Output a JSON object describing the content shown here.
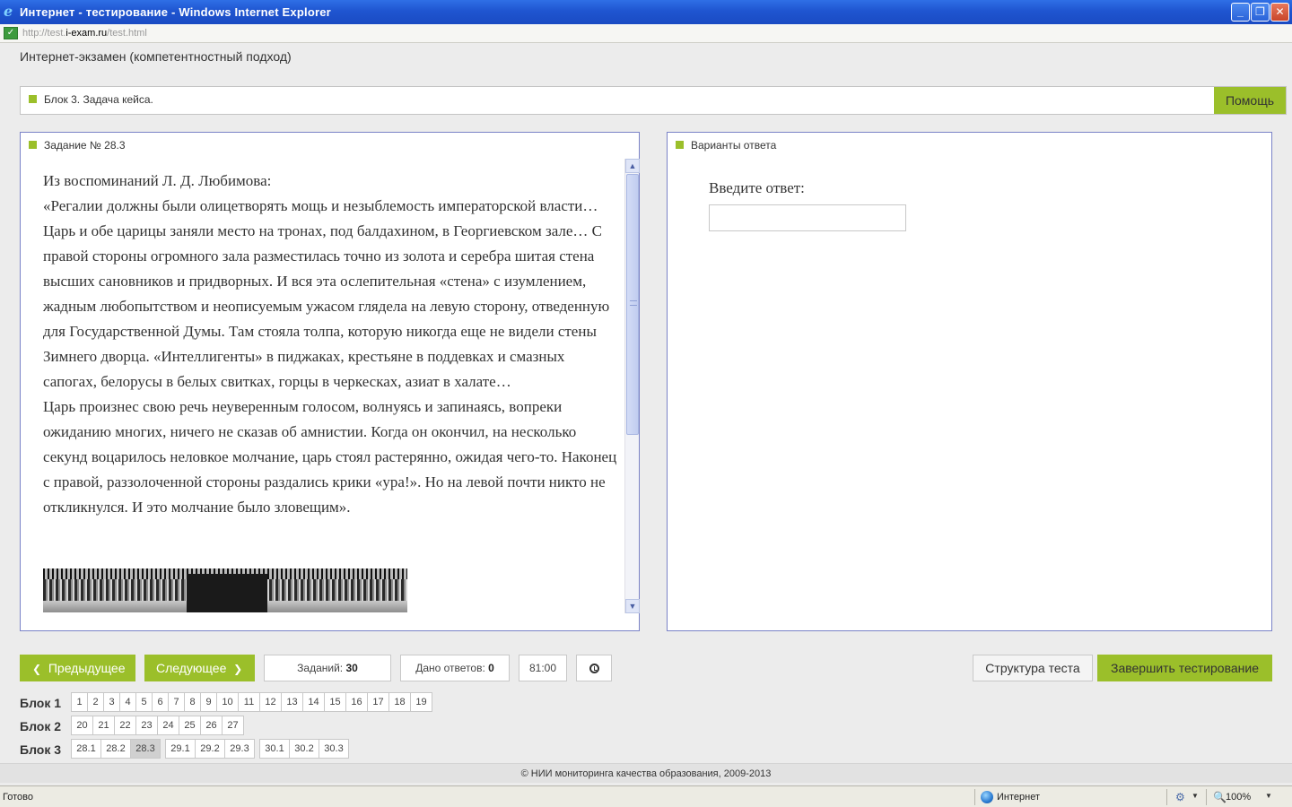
{
  "window": {
    "title": "Интернет - тестирование - Windows Internet Explorer",
    "minimize": "_",
    "maximize": "❐",
    "close": "✕"
  },
  "address": {
    "prefix": "http://test.",
    "host": "i-exam.ru",
    "path": "/test.html"
  },
  "page": {
    "title": "Интернет-экзамен (компетентностный подход)"
  },
  "block_bar": {
    "label": "Блок 3. Задача кейса.",
    "help_label": "Помощь"
  },
  "task": {
    "header": "Задание № 28.3",
    "paragraphs": [
      "Из воспоминаний Л. Д. Любимова:",
      "«Регалии должны были олицетворять мощь и незыблемость императорской власти… Царь и обе царицы заняли место на тронах, под балдахином, в Георгиевском зале… С правой стороны огромного зала разместилась точно из золота и серебра шитая стена высших сановников и придворных. И вся эта ослепительная «стена» с изумлением, жадным любопытством и неописуемым ужасом глядела на левую сторону, отведенную для Государственной Думы. Там стояла толпа, которую никогда еще не видели стены Зимнего дворца. «Интеллигенты» в пиджаках, крестьяне в поддевках и смазных сапогах, белорусы в белых свитках, горцы в черкесках, азиат в халате…",
      "Царь произнес свою речь неуверенным голосом, волнуясь и запинаясь, вопреки ожиданию многих, ничего не сказав об амнистии. Когда он окончил, на несколько секунд воцарилось неловкое молчание, царь стоял растерянно, ожидая чего-то. Наконец с правой, раззолоченной стороны раздались крики «ура!». Но на левой почти никто не откликнулся. И это молчание было зловещим»."
    ]
  },
  "answer": {
    "header": "Варианты ответа",
    "prompt": "Введите ответ:",
    "value": ""
  },
  "nav": {
    "prev_label": "Предыдущее",
    "next_label": "Следующее",
    "tasks_label": "Заданий: ",
    "tasks_value": "30",
    "answers_label": "Дано ответов: ",
    "answers_value": "0",
    "timer": "81:00",
    "structure_label": "Структура теста",
    "finish_label": "Завершить тестирование"
  },
  "blocks": [
    {
      "label": "Блок 1",
      "groups": [
        [
          "1",
          "2",
          "3",
          "4",
          "5",
          "6",
          "7",
          "8",
          "9",
          "10",
          "11",
          "12",
          "13",
          "14",
          "15",
          "16",
          "17",
          "18",
          "19"
        ]
      ]
    },
    {
      "label": "Блок 2",
      "groups": [
        [
          "20",
          "21",
          "22",
          "23",
          "24",
          "25",
          "26",
          "27"
        ]
      ]
    },
    {
      "label": "Блок 3",
      "groups": [
        [
          "28.1",
          "28.2",
          "28.3"
        ],
        [
          "29.1",
          "29.2",
          "29.3"
        ],
        [
          "30.1",
          "30.2",
          "30.3"
        ]
      ]
    }
  ],
  "current_task": "28.3",
  "footer": "© НИИ мониторинга качества образования, 2009-2013",
  "statusbar": {
    "status": "Готово",
    "zone": "Интернет",
    "zoom": "100%"
  },
  "colors": {
    "accent_green": "#9bbf2a",
    "panel_border": "#7a82c7",
    "titlebar_blue": "#1f55d0"
  }
}
